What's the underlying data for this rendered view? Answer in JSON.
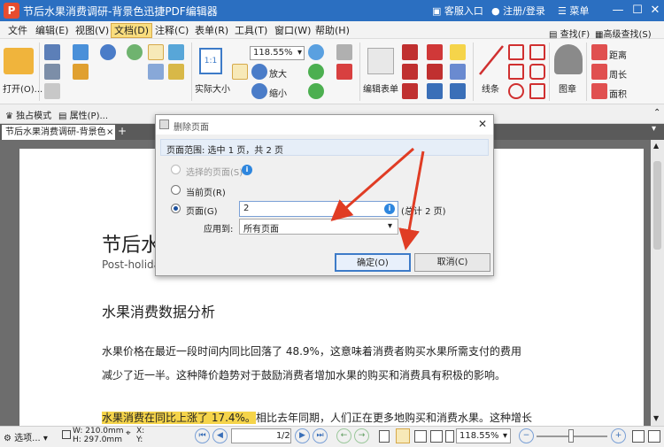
{
  "titlebar": {
    "logo_letter": "P",
    "title": "节后水果消费调研-背景色迅捷PDF编辑器",
    "service": "客服入口",
    "login": "注册/登录",
    "menu": "菜单"
  },
  "menubar": [
    "文件",
    "编辑(E)",
    "视图(V)",
    "文档(D)",
    "注释(C)",
    "表单(R)",
    "工具(T)",
    "窗口(W)",
    "帮助(H)"
  ],
  "ribbon": {
    "open_label": "打开(O)...",
    "zoom_value": "118.55%",
    "actual_size": "实际大小",
    "zoom_in": "放大",
    "zoom_out": "缩小",
    "edit_form": "编辑表单",
    "line": "线条",
    "stamp": "图章",
    "distance": "距离",
    "perimeter": "周长",
    "area": "面积",
    "find": "查找(F)",
    "advanced_find": "高级查找(S)"
  },
  "bar2": {
    "exclusive_mode": "独占模式",
    "properties": "属性(P)..."
  },
  "tab": {
    "label": "节后水果消费调研-背景色",
    "close": "×",
    "add": "+"
  },
  "page": {
    "title": "节后水果消费调研",
    "subtitle": "Post-holiday fruit consumption survey",
    "heading": "水果消费数据分析",
    "para1_line1": "水果价格在最近一段时间内同比回落了  48.9%，这意味着消费者购买水果所需支付的费用",
    "para1_line2": "减少了近一半。这种降价趋势对于鼓励消费者增加水果的购买和消费具有积极的影响。",
    "para2_highlight": "水果消费在同比上涨了 17.4%。",
    "para2_rest": "相比去年同期，人们正在更多地购买和消费水果。这种增长"
  },
  "dialog": {
    "title": "删除页面",
    "range_text": "页面范围: 选中 1 页，共 2 页",
    "opt_selected": "选择的页面(S)",
    "opt_current": "当前页(R)",
    "opt_pages": "页面(G)",
    "pages_value": "2",
    "total_pages": "(总计 2 页)",
    "apply_label": "应用到:",
    "apply_value": "所有页面",
    "ok": "确定(O)",
    "cancel": "取消(C)"
  },
  "status": {
    "options": "选项...",
    "width": "W: 210.0mm",
    "height": "H: 297.0mm",
    "x": "X:",
    "y": "Y:",
    "page_value": "1",
    "page_total": "/2",
    "zoom": "118.55%"
  },
  "colors": {
    "titlebar": "#2b6fc1",
    "highlight": "#f5d44a",
    "arrow": "#e03c24",
    "accent": "#2e86de"
  }
}
